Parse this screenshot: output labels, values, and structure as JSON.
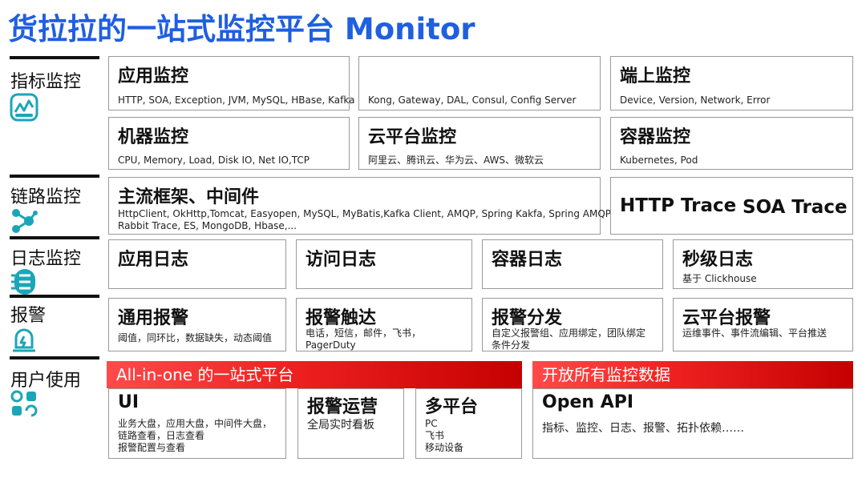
{
  "title": "货拉拉的一站式监控平台 Monitor",
  "categories": [
    {
      "label": "指标监控",
      "icon": "line-chart-icon"
    },
    {
      "label": "链路监控",
      "icon": "network-nodes-icon"
    },
    {
      "label": "日志监控",
      "icon": "log-list-icon"
    },
    {
      "label": "报警",
      "icon": "alarm-bell-icon"
    },
    {
      "label": "用户使用",
      "icon": "grid-apps-icon"
    }
  ],
  "metrics": {
    "app": {
      "title": "应用监控",
      "desc": "HTTP, SOA, Exception, JVM, MySQL, HBase, Kafka"
    },
    "gateway": {
      "desc": "Kong, Gateway, DAL, Consul, Config Server"
    },
    "edge": {
      "title": "端上监控",
      "desc": "Device, Version, Network, Error"
    },
    "machine": {
      "title": "机器监控",
      "desc": "CPU, Memory, Load, Disk IO, Net IO,TCP"
    },
    "cloud": {
      "title": "云平台监控",
      "desc": "阿里云、腾讯云、华为云、AWS、微软云"
    },
    "container": {
      "title": "容器监控",
      "desc": "Kubernetes, Pod"
    }
  },
  "trace": {
    "framework": {
      "title": "主流框架、中间件",
      "line1": "HttpClient, OkHttp,Tomcat, Easyopen, MySQL, MyBatis,Kafka Client, AMQP, Spring Kakfa, Spring AMQP,",
      "line2": "Rabbit Trace, ES, MongoDB, Hbase,..."
    },
    "http": "HTTP Trace",
    "soa": "SOA Trace"
  },
  "logs": {
    "app": "应用日志",
    "access": "访问日志",
    "container": "容器日志",
    "second": {
      "title": "秒级日志",
      "desc": "基于 Clickhouse"
    }
  },
  "alerts": {
    "general": {
      "title": "通用报警",
      "desc": "阈值，同环比，数据缺失，动态阈值"
    },
    "trigger": {
      "title": "报警触达",
      "line1": "电话，短信，邮件，飞书，",
      "line2": "PagerDuty"
    },
    "dispatch": {
      "title": "报警分发",
      "line1": "自定义报警组、应用绑定，团队绑定",
      "line2": "条件分发"
    },
    "cloud": {
      "title": "云平台报警",
      "desc": "运维事件、事件流编辑、平台推送"
    }
  },
  "usage": {
    "banner_left": "All-in-one 的一站式平台",
    "banner_right": "开放所有监控数据",
    "ui": {
      "title": "UI",
      "line1": "业务大盘，应用大盘，中间件大盘，",
      "line2": "链路查看，日志查看",
      "line3": "报警配置与查看"
    },
    "ops": {
      "title": "报警运营",
      "desc": "全局实时看板"
    },
    "multi": {
      "title": "多平台",
      "line1": "PC",
      "line2": "飞书",
      "line3": "移动设备"
    },
    "api": {
      "title": "Open API",
      "desc": "指标、监控、日志、报警、拓扑依赖……"
    }
  },
  "colors": {
    "title": "#1f5fe0",
    "icon": "#1aa6b7",
    "banner": "#e01f1f"
  }
}
